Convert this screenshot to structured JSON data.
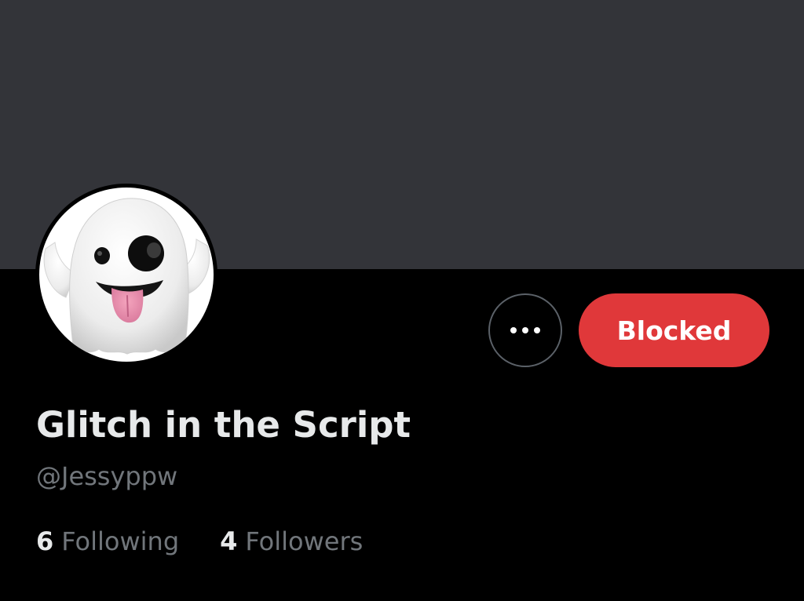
{
  "profile": {
    "display_name": "Glitch in the Script",
    "handle": "@Jessyppw",
    "avatar_icon": "ghost-emoji-icon"
  },
  "actions": {
    "more_icon": "ellipsis-icon",
    "blocked_label": "Blocked"
  },
  "stats": {
    "following_count": "6",
    "following_label": "Following",
    "followers_count": "4",
    "followers_label": "Followers"
  },
  "colors": {
    "background": "#000000",
    "banner": "#333439",
    "blocked_button": "#e0383a",
    "primary_text": "#e7e9ea",
    "secondary_text": "#71767b"
  }
}
